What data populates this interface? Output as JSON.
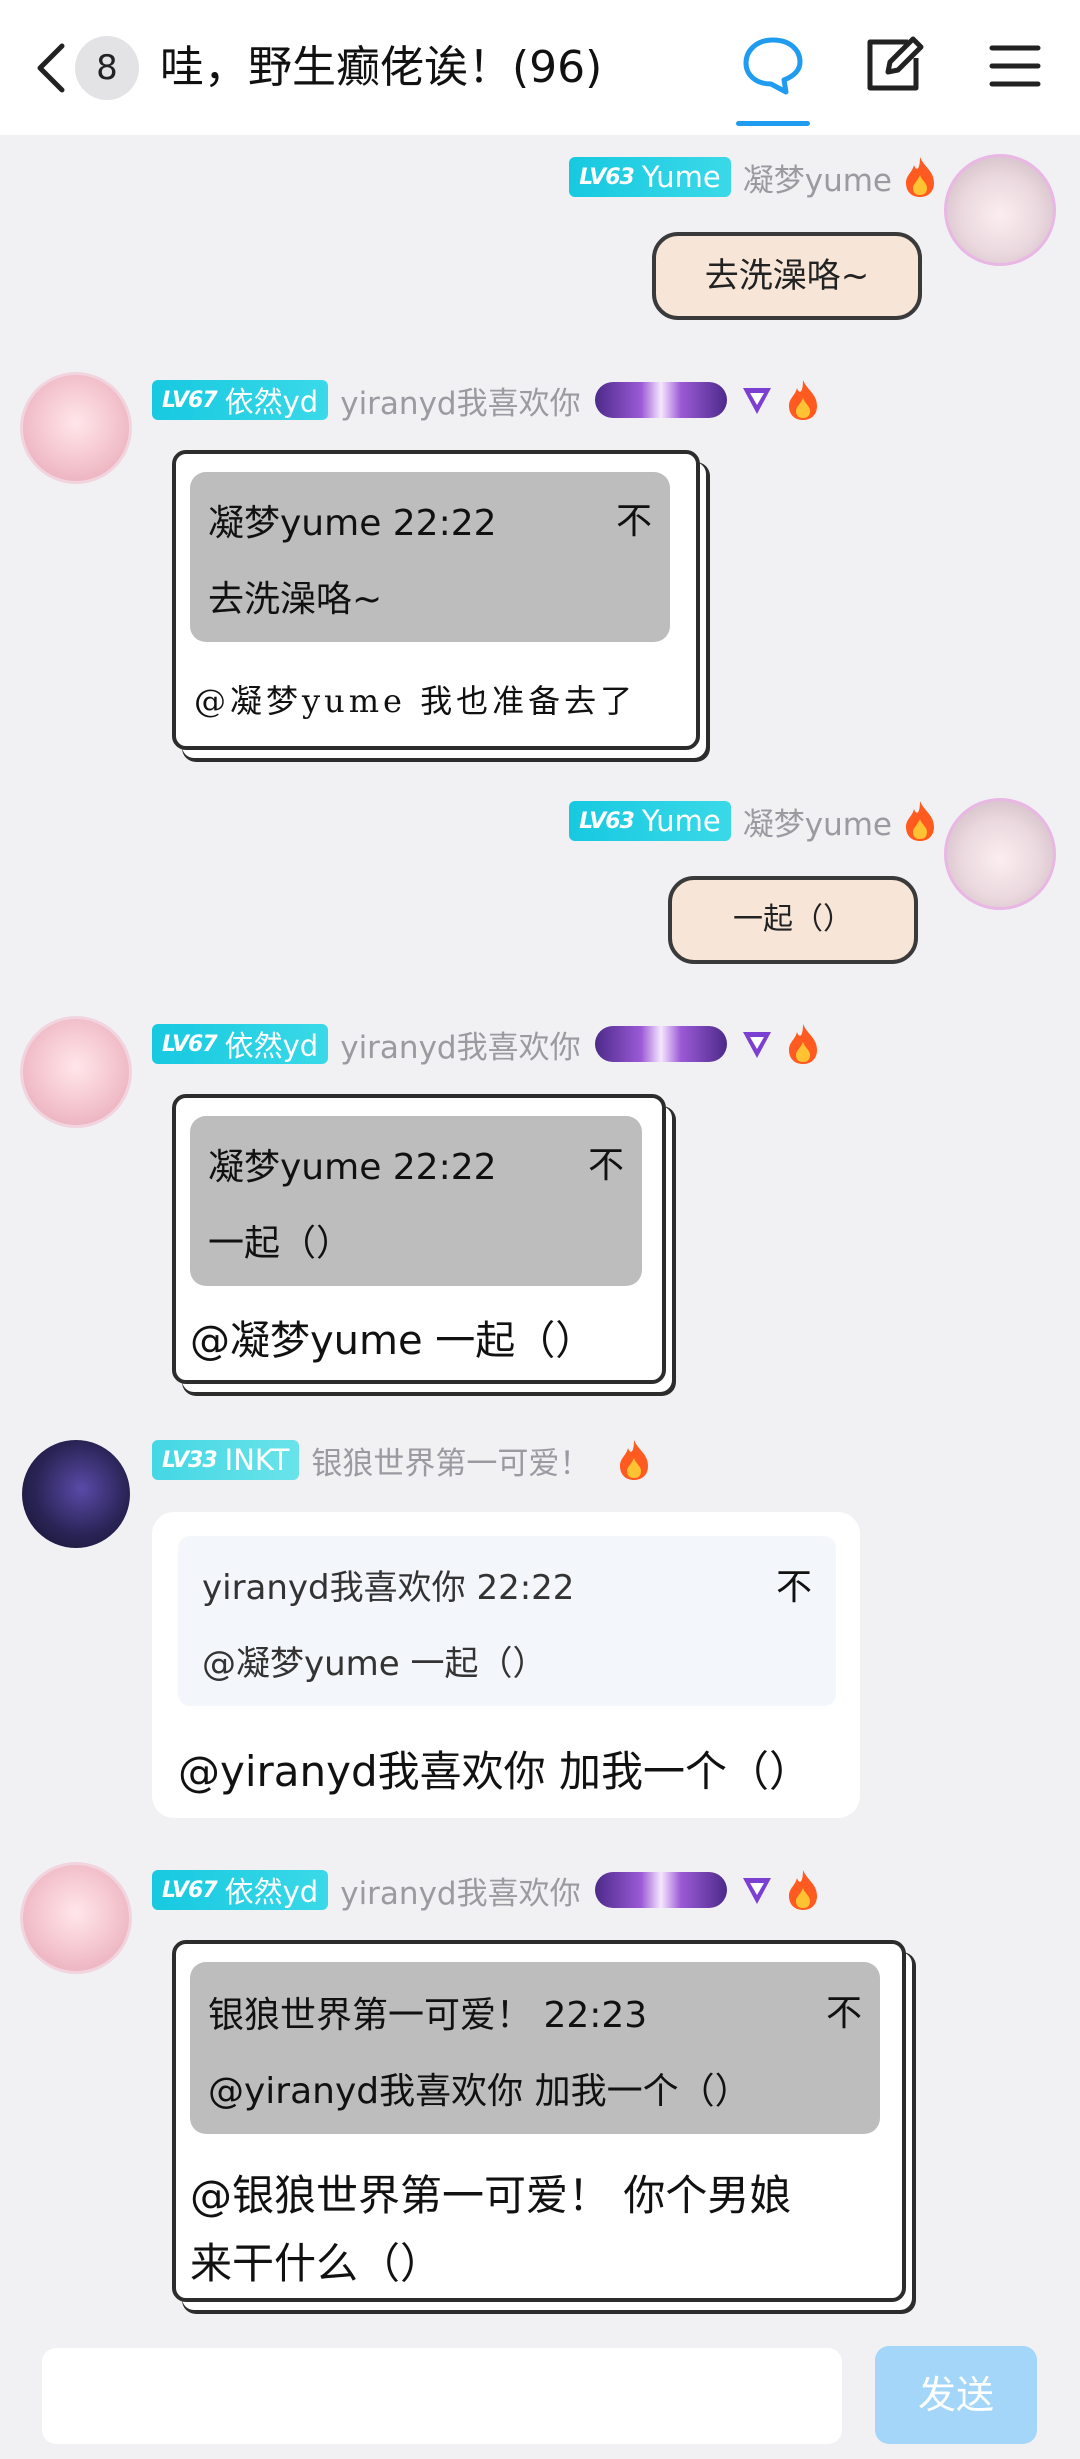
{
  "header": {
    "back_icon": "chevron-left-icon",
    "unread_count": "8",
    "title": "哇，野生癫佬诶！(96)",
    "icons": [
      "chat-bubble-icon",
      "edit-icon",
      "menu-icon"
    ],
    "active_color": "#1f9bf0"
  },
  "messages": [
    {
      "side": "right",
      "level": "LV63",
      "badge_name": "Yume",
      "username": "凝梦yume",
      "bubble_style": "sticker",
      "text": "去洗澡咯~"
    },
    {
      "side": "left",
      "level": "LV67",
      "badge_name": "依然yd",
      "username": "yiranyd我喜欢你",
      "bubble_style": "framed",
      "quote": {
        "author": "凝梦yume 22:22",
        "pin": "不",
        "text": "去洗澡咯~"
      },
      "text": "@凝梦yume 我也准备去了"
    },
    {
      "side": "right",
      "level": "LV63",
      "badge_name": "Yume",
      "username": "凝梦yume",
      "bubble_style": "sticker",
      "text": "一起（）"
    },
    {
      "side": "left",
      "level": "LV67",
      "badge_name": "依然yd",
      "username": "yiranyd我喜欢你",
      "bubble_style": "framed",
      "quote": {
        "author": "凝梦yume 22:22",
        "pin": "不",
        "text": "一起（）"
      },
      "text": "@凝梦yume 一起（）"
    },
    {
      "side": "left",
      "level": "LV33",
      "badge_name": "INKT",
      "username": "银狼世界第一可爱！",
      "bubble_style": "plain",
      "quote": {
        "author": "yiranyd我喜欢你 22:22",
        "pin": "不",
        "text": "@凝梦yume 一起（）"
      },
      "text": "@yiranyd我喜欢你 加我一个（）"
    },
    {
      "side": "left",
      "level": "LV67",
      "badge_name": "依然yd",
      "username": "yiranyd我喜欢你",
      "bubble_style": "framed",
      "quote": {
        "author": "银狼世界第一可爱！ 22:23",
        "pin": "不",
        "text": "@yiranyd我喜欢你 加我一个（）"
      },
      "text_line1": "@银狼世界第一可爱！ 你个男娘",
      "text_line2": "来干什么（）"
    }
  ],
  "composer": {
    "placeholder": "",
    "send_label": "发送",
    "send_color": "#a3d6f8"
  },
  "colors": {
    "background": "#f1f1f4",
    "level_badge": "#17c9e0",
    "username": "#9a9aa0"
  }
}
